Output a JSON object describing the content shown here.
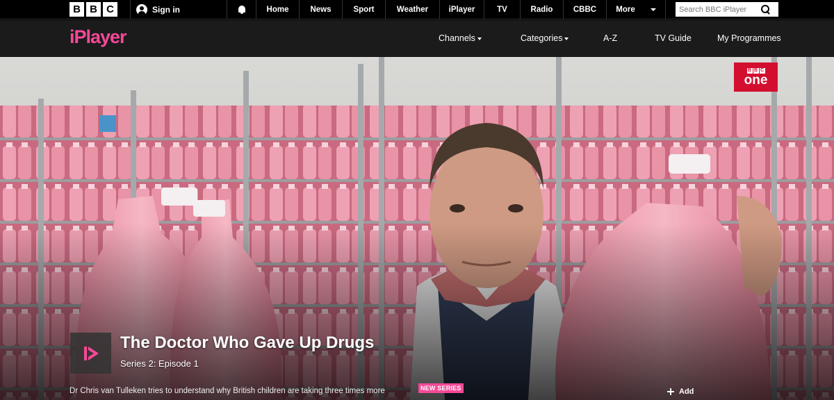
{
  "bbc": {
    "logo_letters": [
      "B",
      "B",
      "C"
    ],
    "sign_in_label": "Sign in",
    "notifications_icon": "bell-icon",
    "nav": [
      {
        "label": "Home"
      },
      {
        "label": "News"
      },
      {
        "label": "Sport"
      },
      {
        "label": "Weather"
      },
      {
        "label": "iPlayer"
      },
      {
        "label": "TV"
      },
      {
        "label": "Radio"
      },
      {
        "label": "CBBC"
      },
      {
        "label": "More"
      }
    ],
    "search": {
      "placeholder": "Search BBC iPlayer"
    }
  },
  "iplayer": {
    "logo": "iPlayer",
    "brand_color": "#f54997",
    "nav": {
      "channels": "Channels",
      "categories": "Categories",
      "az": "A-Z",
      "tv_guide": "TV Guide",
      "my_programmes": "My Programmes"
    }
  },
  "hero": {
    "channel": {
      "logo_letters": [
        "B",
        "B",
        "C"
      ],
      "name": "one",
      "color": "#d40e2f"
    },
    "title": "The Doctor Who Gave Up Drugs",
    "episode": "Series 2: Episode 1",
    "synopsis": "Dr Chris van Tulleken tries to understand why British children are taking three times more",
    "badge": "NEW SERIES",
    "add_label": "Add"
  }
}
